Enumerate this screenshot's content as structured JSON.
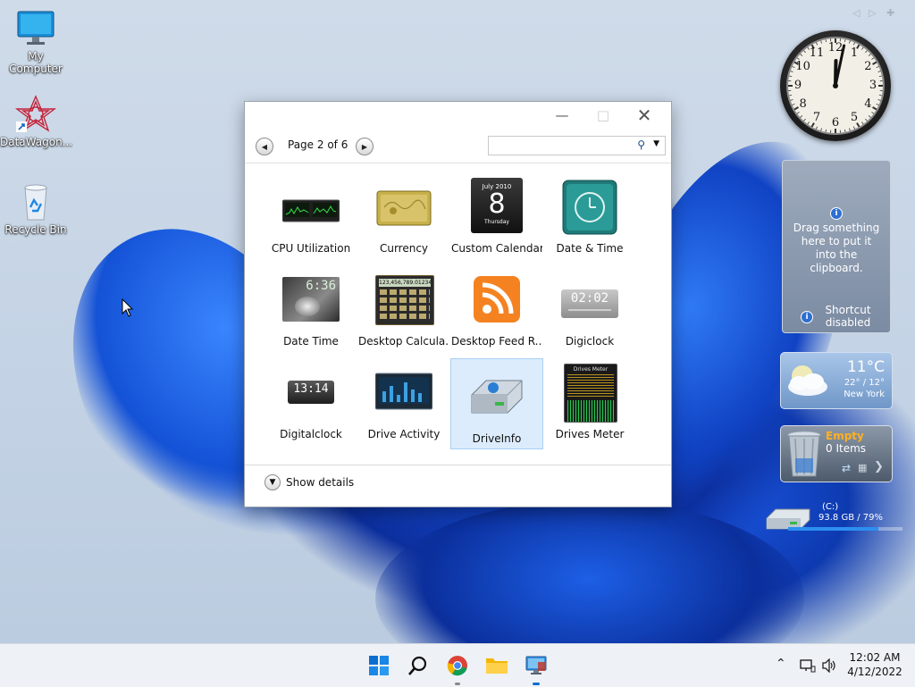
{
  "desktop": {
    "icons": [
      {
        "label": "My Computer"
      },
      {
        "label": "DataWagon..."
      },
      {
        "label": "Recycle Bin"
      }
    ]
  },
  "gadget_window": {
    "page_label": "Page 2 of 6",
    "search_placeholder": "",
    "show_details": "Show details",
    "gadgets": [
      {
        "label": "CPU Utilization",
        "icon": "cpu-meter-icon"
      },
      {
        "label": "Currency",
        "icon": "currency-icon"
      },
      {
        "label": "Custom Calendar",
        "icon": "calendar-icon",
        "cal_month": "July 2010",
        "cal_day": "8",
        "cal_weekday": "Thursday"
      },
      {
        "label": "Date & Time",
        "icon": "clock-icon"
      },
      {
        "label": "Date Time",
        "icon": "date-time-icon",
        "digits": "6:36"
      },
      {
        "label": "Desktop Calcula...",
        "icon": "calculator-icon",
        "display": "123,456,789.01234"
      },
      {
        "label": "Desktop Feed R...",
        "icon": "rss-feed-icon"
      },
      {
        "label": "Digiclock",
        "icon": "digiclock-icon",
        "digits": "02:02"
      },
      {
        "label": "Digitalclock",
        "icon": "digitalclock-icon",
        "digits": "13:14"
      },
      {
        "label": "Drive Activity",
        "icon": "drive-activity-icon"
      },
      {
        "label": "DriveInfo",
        "icon": "drive-info-icon"
      },
      {
        "label": "Drives Meter",
        "icon": "drives-meter-icon",
        "title": "Drives Meter"
      }
    ],
    "selected_index": 10
  },
  "clock_gadget": {
    "numbers": [
      "12",
      "1",
      "2",
      "3",
      "4",
      "5",
      "6",
      "7",
      "8",
      "9",
      "10",
      "11"
    ],
    "hour": 12,
    "minute": 2
  },
  "clipboard_gadget": {
    "message": "Drag something here to put it into the clipboard.",
    "shortcut": "Shortcut disabled"
  },
  "weather_gadget": {
    "temp": "11°C",
    "range": "22° / 12°",
    "city": "New York"
  },
  "recyclebin_gadget": {
    "status": "Empty",
    "items": "0 Items"
  },
  "drive_gadget": {
    "name": "(C:)",
    "usage": "93.8 GB / 79%",
    "fraction": 0.79
  },
  "taskbar": {
    "time": "12:02 AM",
    "date": "4/12/2022"
  },
  "colors": {
    "accent": "#0a6ed1",
    "selection": "#dcecfc",
    "recycle_empty": "#ffb020"
  }
}
